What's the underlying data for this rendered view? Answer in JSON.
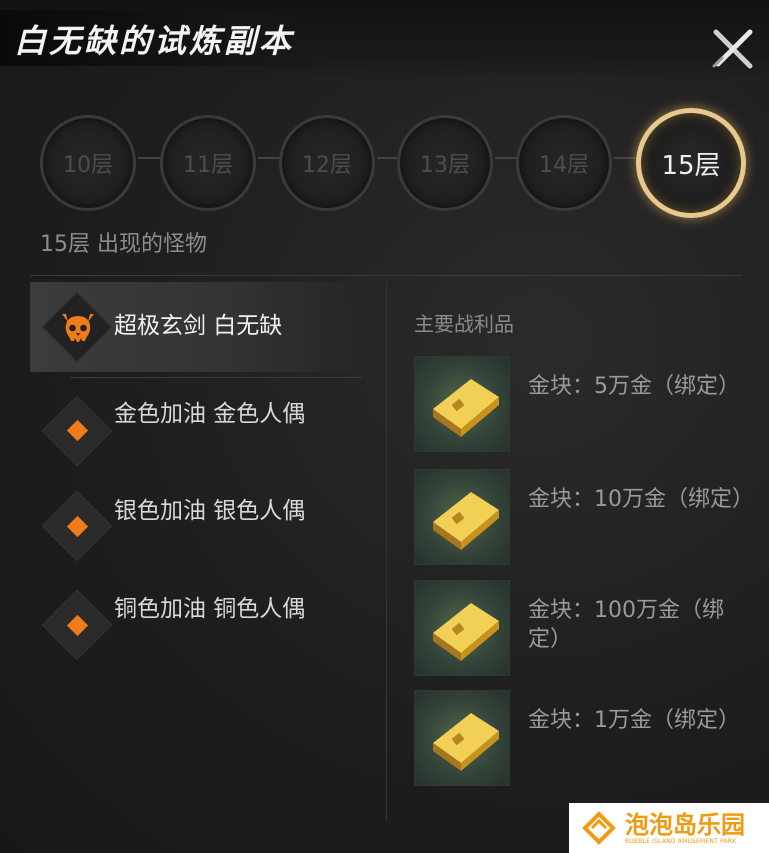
{
  "dialog": {
    "title": "白无缺的试炼副本",
    "close_icon": "close-icon"
  },
  "floors": {
    "items": [
      "10层",
      "11层",
      "12层",
      "13层",
      "14层",
      "15层"
    ],
    "active": "15层"
  },
  "monsters": {
    "heading": "15层 出现的怪物",
    "items": [
      {
        "name": "超极玄剑 白无缺",
        "icon": "skull-icon"
      },
      {
        "name": "金色加油 金色人偶",
        "icon": "diamond-icon"
      },
      {
        "name": "银色加油 银色人偶",
        "icon": "diamond-icon"
      },
      {
        "name": "铜色加油 铜色人偶",
        "icon": "diamond-icon"
      }
    ]
  },
  "loot": {
    "heading": "主要战利品",
    "items": [
      {
        "label": "金块：5万金（绑定）",
        "icon": "gold-bar-icon"
      },
      {
        "label": "金块：10万金（绑定）",
        "icon": "gold-bar-icon"
      },
      {
        "label": "金块：100万金（绑定）",
        "icon": "gold-bar-icon"
      },
      {
        "label": "金块：1万金（绑定）",
        "icon": "gold-bar-icon"
      }
    ]
  },
  "watermark": {
    "name": "泡泡岛乐园",
    "sub": "BUBBLE ISLAND AMUSEMENT PARK"
  },
  "colors": {
    "accent_orange": "#f07b1a",
    "active_ring": "#e7c98b",
    "gold": "#e8b83a"
  }
}
